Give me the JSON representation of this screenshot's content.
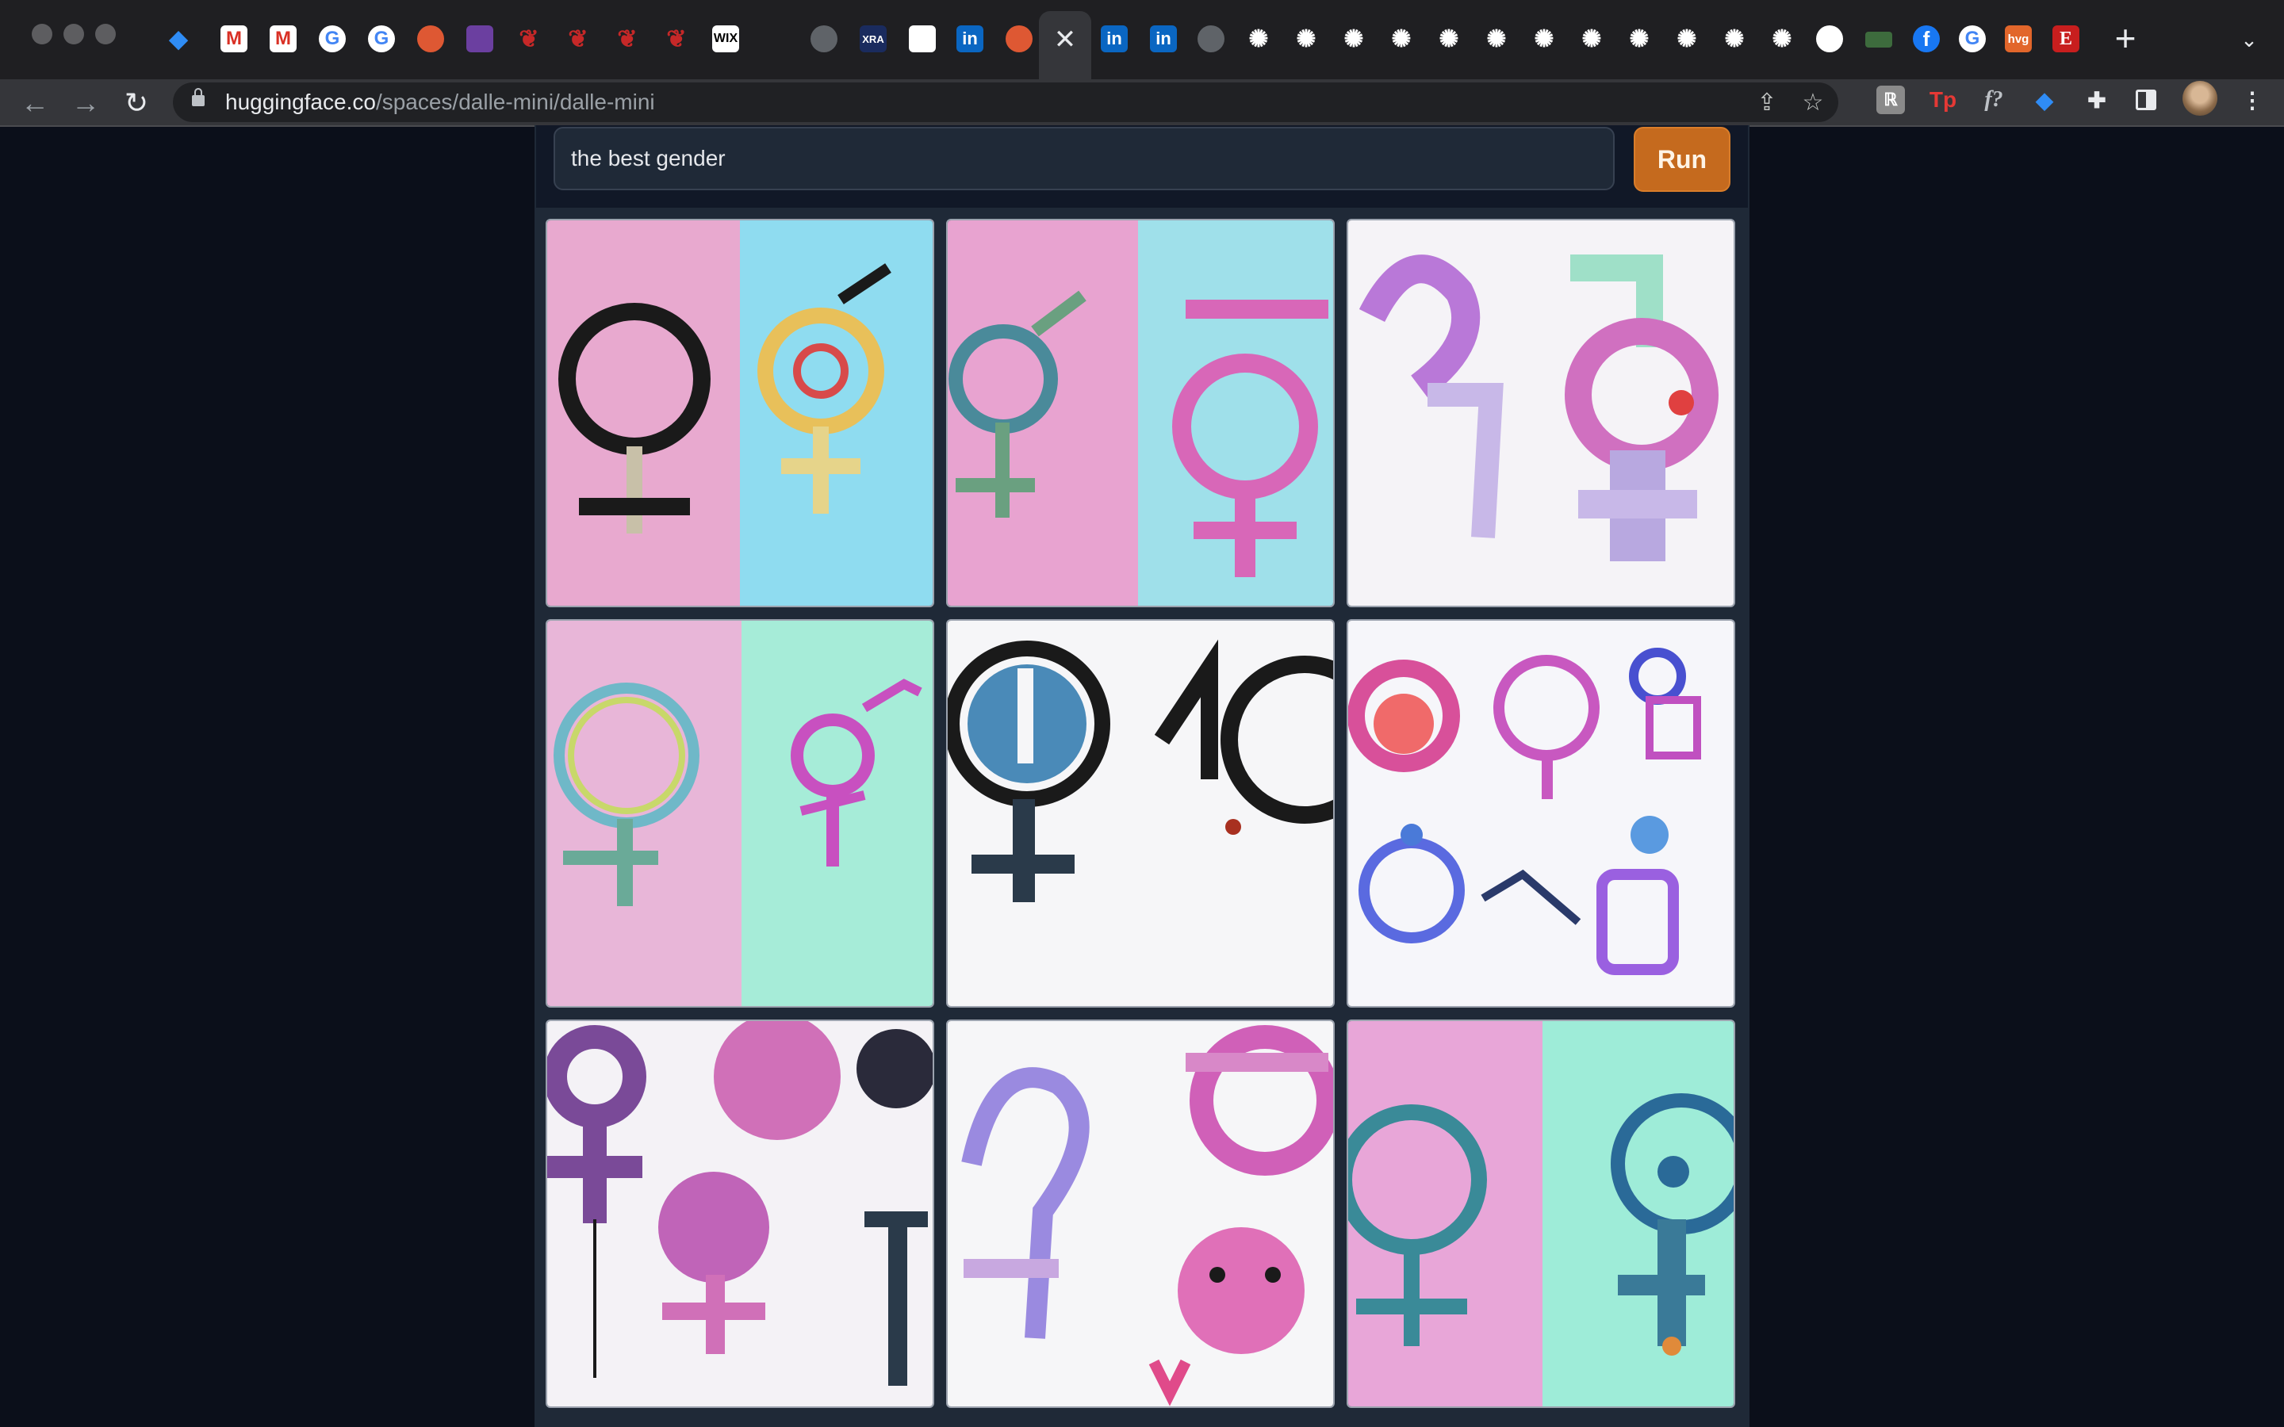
{
  "browser": {
    "url_domain": "huggingface.co",
    "url_path": "/spaces/dalle-mini/dalle-mini",
    "tabs": [
      {
        "icon": "gem-icon"
      },
      {
        "icon": "gmail-icon"
      },
      {
        "icon": "gmail-icon"
      },
      {
        "icon": "google-icon"
      },
      {
        "icon": "google-icon"
      },
      {
        "icon": "duckduckgo-icon"
      },
      {
        "icon": "app-icon"
      },
      {
        "icon": "feather-icon"
      },
      {
        "icon": "feather-icon"
      },
      {
        "icon": "feather-icon"
      },
      {
        "icon": "feather-icon"
      },
      {
        "label": "WIX",
        "icon": "wix-icon"
      },
      {
        "icon": "globe-icon"
      },
      {
        "label": "XRA",
        "icon": "xra-icon"
      },
      {
        "icon": "blank-icon"
      },
      {
        "label": "in",
        "icon": "linkedin-icon"
      },
      {
        "icon": "duckduckgo-icon"
      },
      {
        "label": "in",
        "icon": "linkedin-icon"
      },
      {
        "label": "in",
        "icon": "linkedin-icon"
      },
      {
        "icon": "globe-icon"
      },
      {
        "icon": "openai-icon"
      },
      {
        "icon": "github-icon"
      },
      {
        "icon": "tab-icon"
      },
      {
        "label": "f",
        "icon": "facebook-icon"
      },
      {
        "icon": "google-icon"
      },
      {
        "label": "hvg",
        "icon": "hvg-icon"
      },
      {
        "label": "E",
        "icon": "e-icon"
      }
    ],
    "extensions": [
      {
        "label": "ℝ",
        "icon": "r-extension-icon"
      },
      {
        "label": "Tp",
        "icon": "tp-extension-icon"
      },
      {
        "label": "f?",
        "icon": "font-extension-icon"
      },
      {
        "icon": "gem-extension-icon"
      },
      {
        "icon": "puzzle-icon"
      },
      {
        "icon": "sidebar-icon"
      }
    ]
  },
  "app": {
    "prompt_value": "the best gender",
    "run_label": "Run",
    "accent_color": "#c56a1e",
    "images_count": 9
  }
}
